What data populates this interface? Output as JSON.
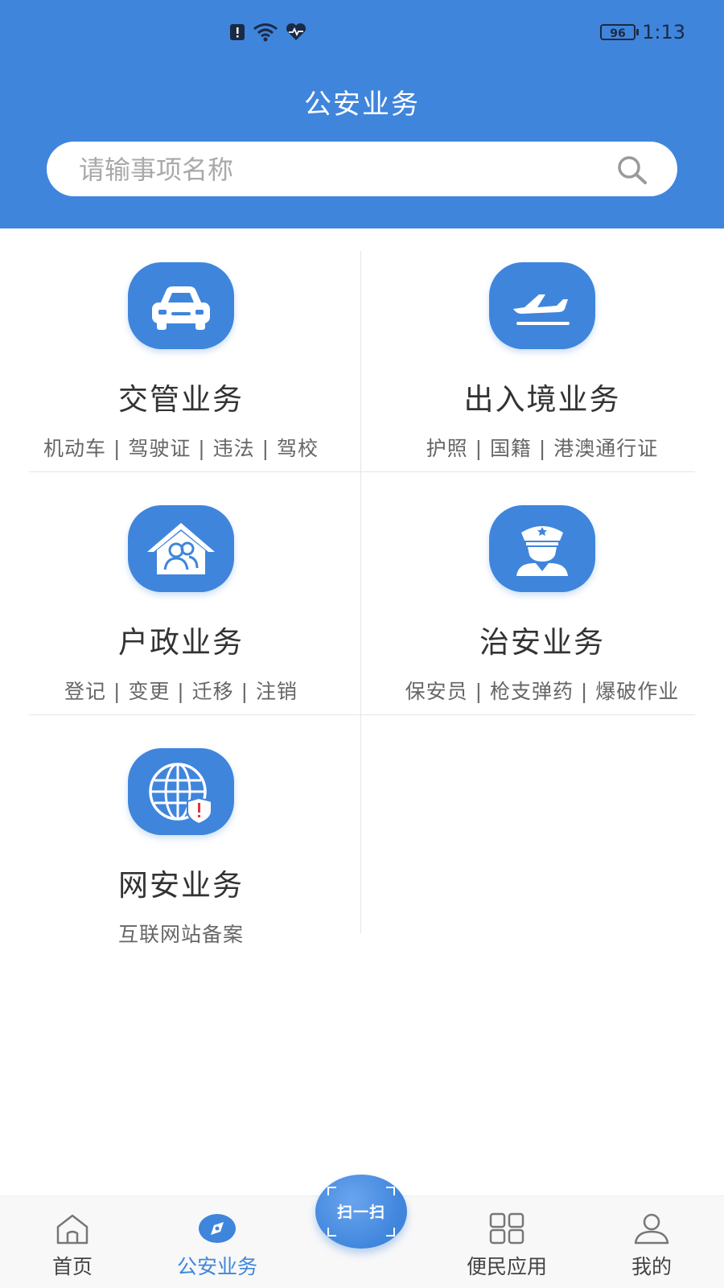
{
  "status_bar": {
    "battery": "96",
    "time": "1:13"
  },
  "header": {
    "title": "公安业务"
  },
  "search": {
    "placeholder": "请输事项名称",
    "icon": "search-icon"
  },
  "services": [
    {
      "name": "交管业务",
      "desc": "机动车 | 驾驶证 | 违法 | 驾校",
      "icon": "car-icon"
    },
    {
      "name": "出入境业务",
      "desc": "护照 | 国籍 | 港澳通行证",
      "icon": "airplane-icon"
    },
    {
      "name": "户政业务",
      "desc": "登记 | 变更 | 迁移 | 注销",
      "icon": "household-icon"
    },
    {
      "name": "治安业务",
      "desc": "保安员 | 枪支弹药 | 爆破作业",
      "icon": "police-officer-icon"
    },
    {
      "name": "网安业务",
      "desc": "互联网站备案",
      "icon": "globe-shield-icon"
    }
  ],
  "tabbar": {
    "items": [
      {
        "label": "首页",
        "icon": "home-icon"
      },
      {
        "label": "公安业务",
        "icon": "compass-icon",
        "active": true
      },
      {
        "label": "便民应用",
        "icon": "grid-icon"
      },
      {
        "label": "我的",
        "icon": "user-icon"
      }
    ],
    "scan_label": "扫一扫"
  },
  "colors": {
    "accent": "#3f85dc",
    "background": "#ffffff",
    "tabbar_bg": "#f8f8f8"
  }
}
